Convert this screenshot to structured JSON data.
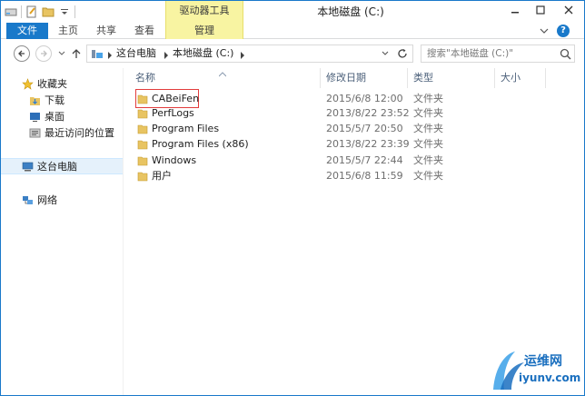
{
  "window": {
    "title": "本地磁盘 (C:)",
    "context_tab_group": "驱动器工具"
  },
  "ribbon": {
    "tabs": [
      {
        "label": "文件"
      },
      {
        "label": "主页"
      },
      {
        "label": "共享"
      },
      {
        "label": "查看"
      },
      {
        "label": "管理"
      }
    ]
  },
  "address": {
    "crumbs": [
      "这台电脑",
      "本地磁盘 (C:)"
    ]
  },
  "search": {
    "placeholder": "搜索\"本地磁盘 (C:)\""
  },
  "nav_pane": {
    "favorites": {
      "label": "收藏夹",
      "icon": "star-icon"
    },
    "favorite_items": [
      {
        "label": "下载",
        "icon": "download-folder-icon"
      },
      {
        "label": "桌面",
        "icon": "desktop-icon"
      },
      {
        "label": "最近访问的位置",
        "icon": "recent-places-icon"
      }
    ],
    "this_pc": {
      "label": "这台电脑",
      "icon": "computer-icon"
    },
    "network": {
      "label": "网络",
      "icon": "network-icon"
    }
  },
  "columns": {
    "name": "名称",
    "date": "修改日期",
    "type": "类型",
    "size": "大小"
  },
  "files": [
    {
      "name": "CABeiFen",
      "date": "2015/6/8 12:00",
      "type": "文件夹"
    },
    {
      "name": "PerfLogs",
      "date": "2013/8/22 23:52",
      "type": "文件夹"
    },
    {
      "name": "Program Files",
      "date": "2015/5/7 20:50",
      "type": "文件夹"
    },
    {
      "name": "Program Files (x86)",
      "date": "2013/8/22 23:39",
      "type": "文件夹"
    },
    {
      "name": "Windows",
      "date": "2015/5/7 22:44",
      "type": "文件夹"
    },
    {
      "name": "用户",
      "date": "2015/6/8 11:59",
      "type": "文件夹"
    }
  ],
  "watermark": {
    "line1": "运维网",
    "line2": "iyunv.com"
  },
  "colors": {
    "accent": "#1979ca",
    "context_tab": "#f8f4a2",
    "folder": "#e8c462",
    "highlight_box": "#e23c3c"
  }
}
